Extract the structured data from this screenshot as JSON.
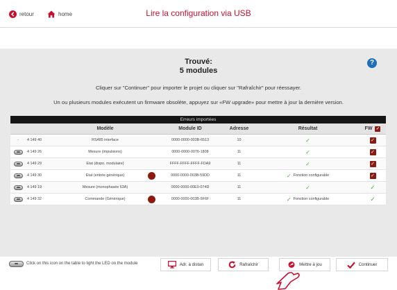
{
  "nav": {
    "back_label": "retour",
    "home_label": "home",
    "title": "Lire la configuration via USB"
  },
  "status": {
    "found_line1": "Trouvé:",
    "found_line2": "5 modules",
    "help_symbol": "?"
  },
  "instructions": {
    "line1": "Cliquer sur \"Continuer\" pour importer le projet ou cliquer sur \"Rafraîchir\" pour réessayer.",
    "line2": "Un ou plusieurs modules exécutent un firmware obsolète, appuyez sur «FW upgrade» pour mettre à jour la dernière version."
  },
  "table": {
    "banner": "Erreurs importées",
    "headers": {
      "model": "Modèle",
      "module_id": "Module ID",
      "address": "Adresse",
      "result": "Résultat",
      "fw": "FW"
    },
    "rows": [
      {
        "led": "-",
        "code": "4 149 40",
        "model": "RS485 interface",
        "id": "0000-0000-003B-6513",
        "address": "10",
        "result": "",
        "fw": "box",
        "warn": false
      },
      {
        "led": "button",
        "code": "4 149 26",
        "model": "Mesure (impulsions)",
        "id": "0000-0000-0076-1808",
        "address": "11",
        "result": "",
        "fw": "box",
        "warn": false
      },
      {
        "led": "button",
        "code": "4 149 29",
        "model": "Etat (dispo. modulaire)",
        "id": "FFFF-FFFF-FFFF-FDA9",
        "address": "11",
        "result": "",
        "fw": "box",
        "warn": false
      },
      {
        "led": "button",
        "code": "4 149 30",
        "model": "Etat (entrée générique)",
        "id": "0000-0000-003B-59DD",
        "address": "11",
        "result": "Fonction configurable",
        "fw": "box",
        "warn": true
      },
      {
        "led": "button",
        "code": "4 149 19",
        "model": "Mesure (monophasée 63A)",
        "id": "0000-0000-00E0-074D",
        "address": "11",
        "result": "",
        "fw": "check",
        "warn": false
      },
      {
        "led": "button",
        "code": "4 149 32",
        "model": "Commande (Générique)",
        "id": "0000-0000-003B-5F6F",
        "address": "11",
        "result": "Fonction configurable",
        "fw": "check",
        "warn": true
      }
    ]
  },
  "footer": {
    "led_hint": "Click on this icon on the table to light the LED on the module",
    "adr_label": "Adr. à distan",
    "refresh_label": "Rafraîchir",
    "fw_label": "Mettre à jou",
    "continue_label": "Continuer"
  },
  "colors": {
    "accent_red": "#c8102e",
    "dark_red": "#8b1a12",
    "check_green": "#4caf3a",
    "help_blue": "#1c6fb8"
  },
  "icons": {
    "back": "back-arrow-icon",
    "home": "home-icon",
    "adr": "monitor-icon",
    "refresh": "refresh-icon",
    "fw": "firmware-upgrade-icon",
    "continue": "checkmark-icon"
  }
}
